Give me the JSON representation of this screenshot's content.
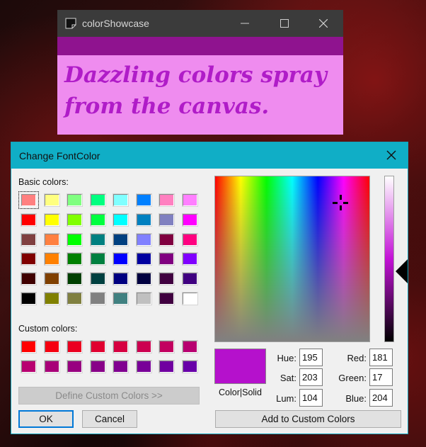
{
  "app": {
    "title": "colorShowcase",
    "showcase_text": "Dazzling colors spray from the canvas.",
    "strip_color": "#8f138f",
    "canvas_color": "#ef8cef",
    "text_color": "#b01cc8"
  },
  "dialog": {
    "title": "Change FontColor",
    "basic_colors_label": "Basic colors:",
    "custom_colors_label": "Custom colors:",
    "basic_colors": [
      [
        "#ff8080",
        "#ffff80",
        "#80ff80",
        "#00ff80",
        "#80ffff",
        "#0080ff",
        "#ff80c0",
        "#ff80ff"
      ],
      [
        "#ff0000",
        "#ffff00",
        "#80ff00",
        "#00ff40",
        "#00ffff",
        "#0080c0",
        "#8080c0",
        "#ff00ff"
      ],
      [
        "#804040",
        "#ff8040",
        "#00ff00",
        "#008080",
        "#004080",
        "#8080ff",
        "#800040",
        "#ff0080"
      ],
      [
        "#800000",
        "#ff8000",
        "#008000",
        "#008040",
        "#0000ff",
        "#0000a0",
        "#800080",
        "#8000ff"
      ],
      [
        "#400000",
        "#804000",
        "#004000",
        "#004040",
        "#000080",
        "#000040",
        "#400040",
        "#400080"
      ],
      [
        "#000000",
        "#808000",
        "#808040",
        "#808080",
        "#408080",
        "#c0c0c0",
        "#400040",
        "#ffffff"
      ]
    ],
    "custom_colors": [
      [
        "#ff0000",
        "#f50010",
        "#eb0020",
        "#e00030",
        "#d60040",
        "#cc0050",
        "#c20060",
        "#b80070"
      ],
      [
        "#b80070",
        "#a80078",
        "#980080",
        "#880088",
        "#800090",
        "#780098",
        "#7000a0",
        "#6800a8"
      ]
    ],
    "define_custom_button": "Define Custom Colors >>",
    "ok_button": "OK",
    "cancel_button": "Cancel",
    "preview_label": "Color|Solid",
    "preview_color": "#b511cc",
    "hue_label": "Hue:",
    "hue": "195",
    "sat_label": "Sat:",
    "sat": "203",
    "lum_label": "Lum:",
    "lum": "104",
    "red_label": "Red:",
    "red": "181",
    "green_label": "Green:",
    "green": "17",
    "blue_label": "Blue:",
    "blue": "204",
    "add_custom_button": "Add to Custom Colors"
  }
}
